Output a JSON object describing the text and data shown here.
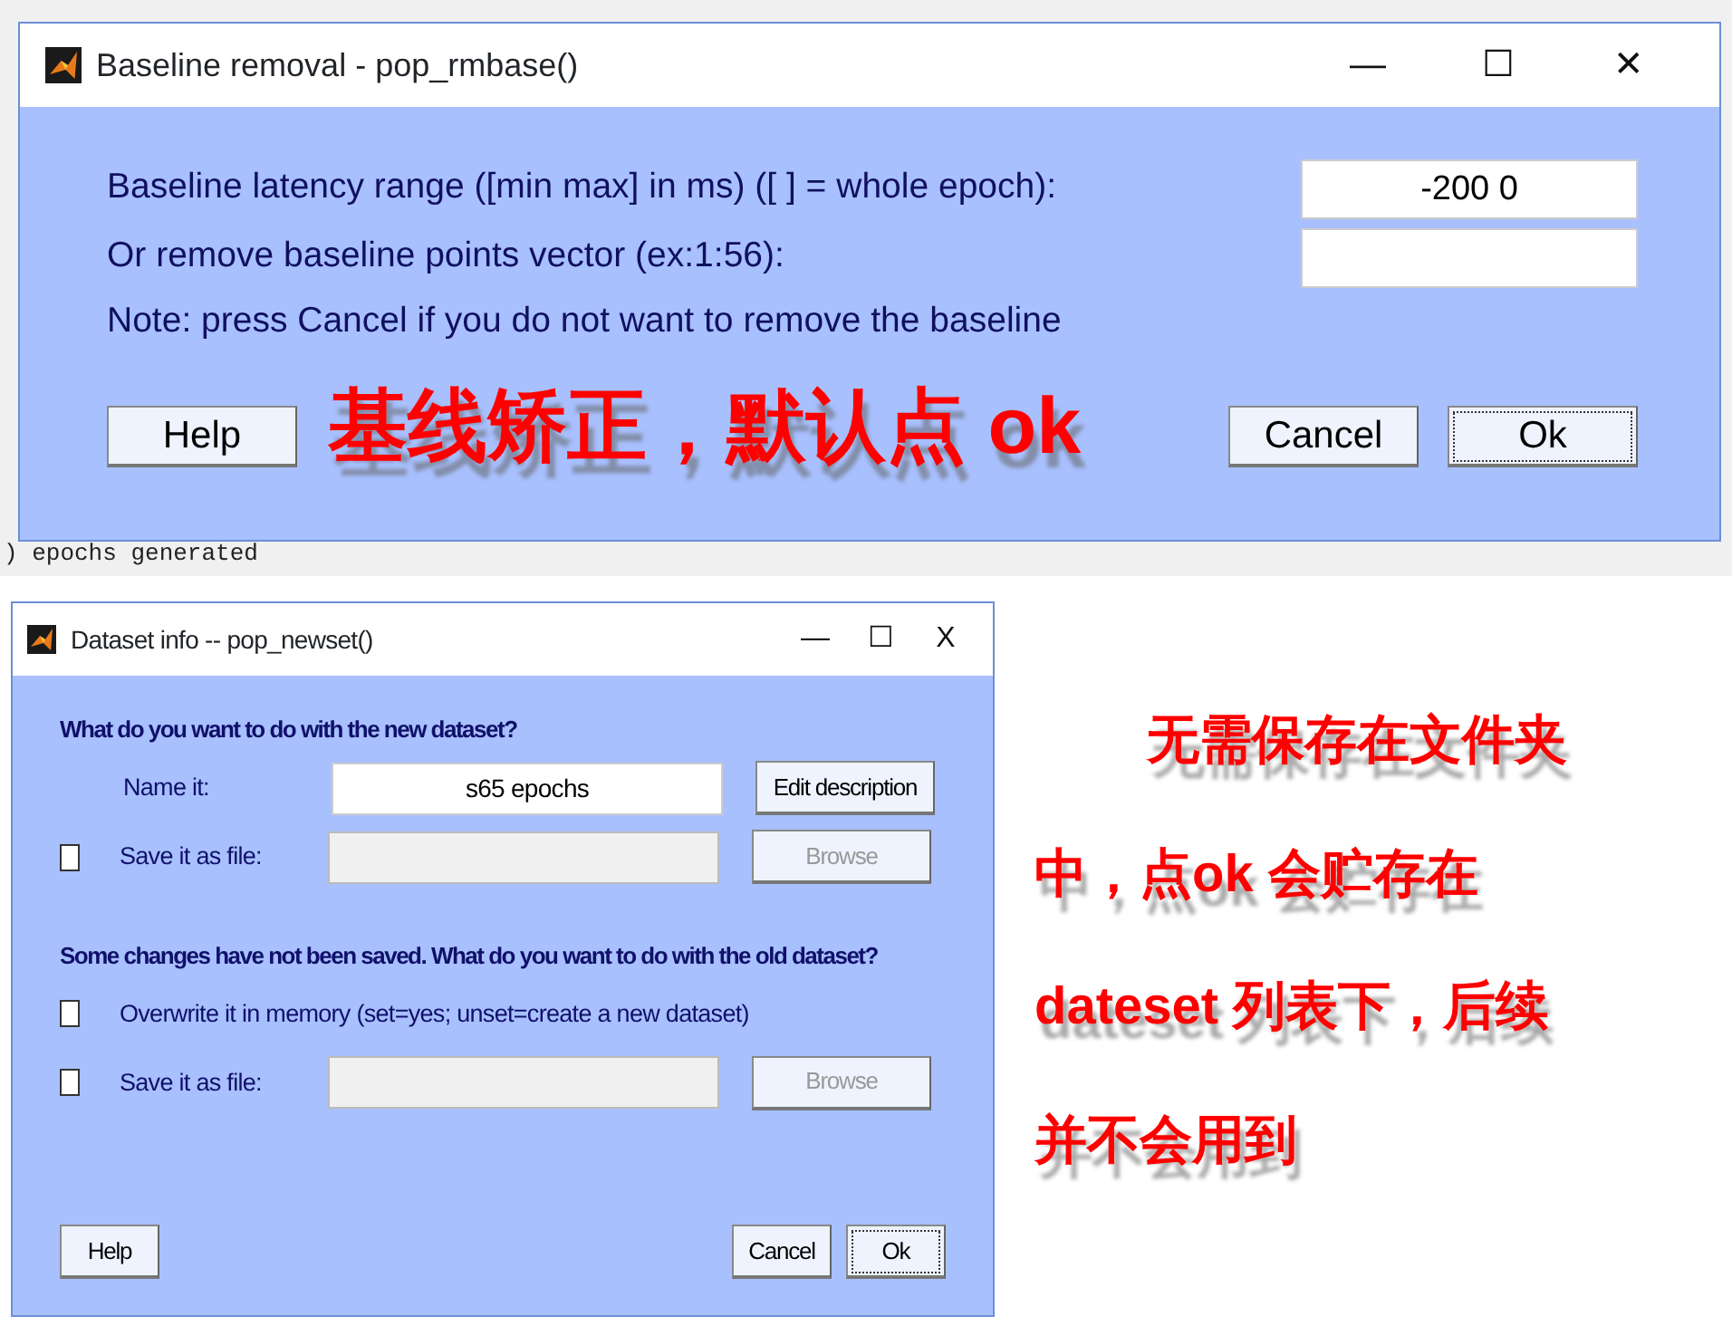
{
  "background_console": {
    "text": ") epochs generated"
  },
  "baseline_dialog": {
    "title": "Baseline removal - pop_rmbase()",
    "window_controls": [
      "—",
      "☐",
      "✕"
    ],
    "fields": [
      {
        "label": "Baseline latency range ([min max] in ms) ([ ] = whole epoch):",
        "value": "-200 0"
      },
      {
        "label": "Or remove baseline points vector (ex:1:56):"
      }
    ],
    "note": "Note: press Cancel if you do not want to remove the baseline",
    "buttons": [
      {
        "label": "Help",
        "focused": false
      },
      {
        "label": "Cancel",
        "focused": false
      },
      {
        "label": "Ok",
        "focused": true
      }
    ],
    "annotation": "基线矫正，默认点 ok"
  },
  "dataset_dialog": {
    "title": "Dataset info -- pop_newset()",
    "window_controls": [
      "—",
      "☐",
      "X"
    ],
    "sections": [
      {
        "heading": "What do you want to do with the new dataset?",
        "rows": [
          {
            "kind": "field",
            "label": "Name it:",
            "value": "s65 epochs",
            "disabled": false,
            "button": {
              "label": "Edit description",
              "disabled": false
            }
          },
          {
            "kind": "file",
            "checked": false,
            "label": "Save it as file:",
            "disabled": true,
            "button": {
              "label": "Browse",
              "disabled": true
            }
          }
        ]
      },
      {
        "heading": "Some changes have not been saved. What do you want to do with the old dataset?",
        "rows": [
          {
            "kind": "check",
            "checked": false,
            "label": "Overwrite it in memory (set=yes; unset=create a new dataset)"
          },
          {
            "kind": "file",
            "checked": false,
            "label": "Save it as file:",
            "disabled": true,
            "button": {
              "label": "Browse",
              "disabled": true
            }
          }
        ]
      }
    ],
    "buttons": [
      {
        "label": "Help",
        "focused": false
      },
      {
        "label": "Cancel",
        "focused": false
      },
      {
        "label": "Ok",
        "focused": true
      }
    ]
  },
  "annotation_lines": [
    "无需保存在文件夹",
    "中，点ok 会贮存在",
    "dateset 列表下，后续",
    "并不会用到"
  ]
}
